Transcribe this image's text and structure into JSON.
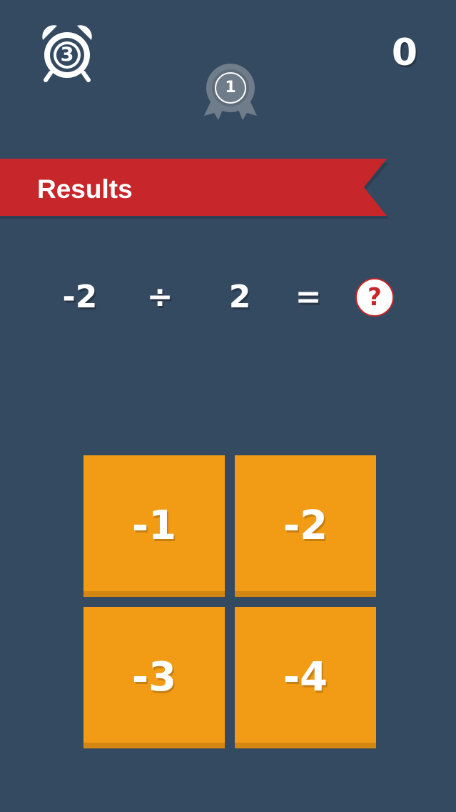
{
  "timer": {
    "value": "3",
    "icon": "alarm-clock-icon"
  },
  "score": {
    "value": "0"
  },
  "level_badge": {
    "value": "1",
    "icon": "ribbon-badge-icon"
  },
  "banner": {
    "title": "Results"
  },
  "equation": {
    "operand_a": "-2",
    "operator": "÷",
    "operand_b": "2",
    "equals": "=",
    "unknown": "?"
  },
  "answers": [
    "-1",
    "-2",
    "-3",
    "-4"
  ],
  "colors": {
    "background": "#344a61",
    "banner_red": "#c7262a",
    "tile_orange": "#f29c15",
    "badge_gray": "#6f7c8a"
  }
}
